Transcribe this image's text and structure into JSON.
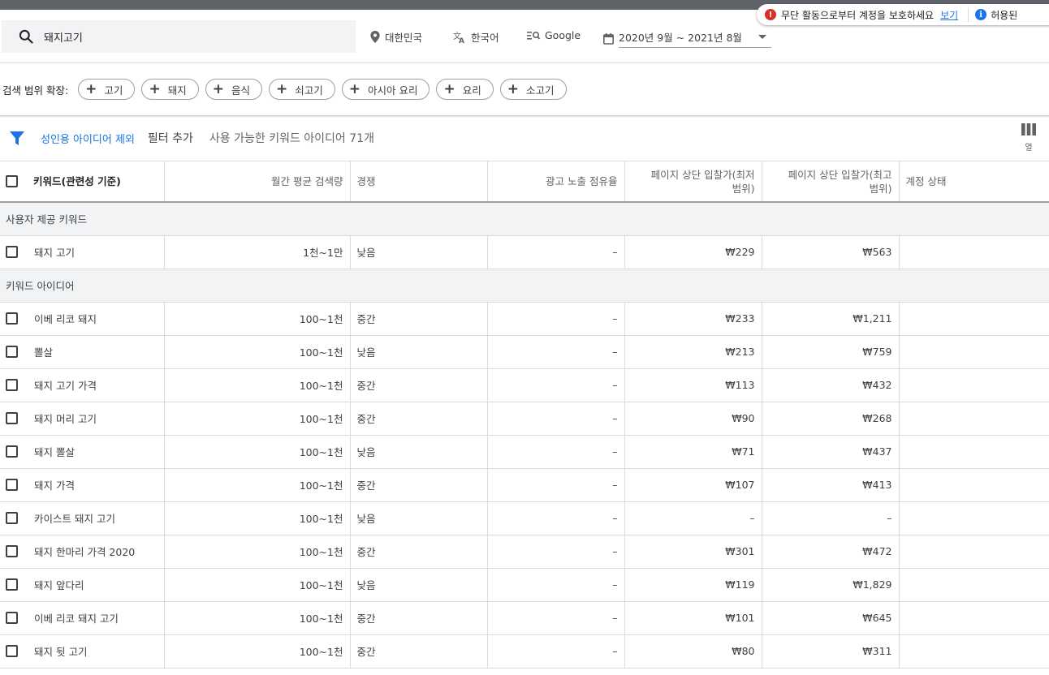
{
  "notice": {
    "warning_text": "무단 활동으로부터 계정을 보호하세요",
    "link_label": "보기",
    "info_text": "허용된"
  },
  "search": {
    "value": "돼지고기"
  },
  "settings": {
    "location": "대한민국",
    "language": "한국어",
    "network": "Google",
    "date_range": "2020년 9월 ~ 2021년 8월"
  },
  "broaden": {
    "label": "검색 범위 확장:",
    "chips": [
      "고기",
      "돼지",
      "음식",
      "쇠고기",
      "아시아 요리",
      "요리",
      "소고기"
    ]
  },
  "filterbar": {
    "adult_exclude": "성인용 아이디어 제외",
    "add_filter": "필터 추가",
    "count_text": "사용 가능한 키워드 아이디어 71개"
  },
  "columns_button": {
    "label": "열"
  },
  "table": {
    "headers": {
      "keyword": "키워드(관련성 기준)",
      "monthly": "월간 평균 검색량",
      "competition": "경쟁",
      "impression_share": "광고 노출 점유율",
      "bid_low_line1": "페이지 상단 입찰가(최저",
      "bid_low_line2": "범위)",
      "bid_high_line1": "페이지 상단 입찰가(최고",
      "bid_high_line2": "범위)",
      "account_status": "계정 상태"
    },
    "group_provided": "사용자 제공 키워드",
    "provided_rows": [
      {
        "keyword": "돼지 고기",
        "monthly": "1천~1만",
        "competition": "낮음",
        "share": "–",
        "low": "₩229",
        "high": "₩563"
      }
    ],
    "group_ideas": "키워드 아이디어",
    "idea_rows": [
      {
        "keyword": "이베 리코 돼지",
        "monthly": "100~1천",
        "competition": "중간",
        "share": "–",
        "low": "₩233",
        "high": "₩1,211"
      },
      {
        "keyword": "뽈살",
        "monthly": "100~1천",
        "competition": "낮음",
        "share": "–",
        "low": "₩213",
        "high": "₩759"
      },
      {
        "keyword": "돼지 고기 가격",
        "monthly": "100~1천",
        "competition": "중간",
        "share": "–",
        "low": "₩113",
        "high": "₩432"
      },
      {
        "keyword": "돼지 머리 고기",
        "monthly": "100~1천",
        "competition": "중간",
        "share": "–",
        "low": "₩90",
        "high": "₩268"
      },
      {
        "keyword": "돼지 뽈살",
        "monthly": "100~1천",
        "competition": "낮음",
        "share": "–",
        "low": "₩71",
        "high": "₩437"
      },
      {
        "keyword": "돼지 가격",
        "monthly": "100~1천",
        "competition": "중간",
        "share": "–",
        "low": "₩107",
        "high": "₩413"
      },
      {
        "keyword": "카이스트 돼지 고기",
        "monthly": "100~1천",
        "competition": "낮음",
        "share": "–",
        "low": "–",
        "high": "–"
      },
      {
        "keyword": "돼지 한마리 가격 2020",
        "monthly": "100~1천",
        "competition": "중간",
        "share": "–",
        "low": "₩301",
        "high": "₩472"
      },
      {
        "keyword": "돼지 앞다리",
        "monthly": "100~1천",
        "competition": "낮음",
        "share": "–",
        "low": "₩119",
        "high": "₩1,829"
      },
      {
        "keyword": "이베 리코 돼지 고기",
        "monthly": "100~1천",
        "competition": "중간",
        "share": "–",
        "low": "₩101",
        "high": "₩645"
      },
      {
        "keyword": "돼지 뒷 고기",
        "monthly": "100~1천",
        "competition": "중간",
        "share": "–",
        "low": "₩80",
        "high": "₩311"
      }
    ]
  }
}
